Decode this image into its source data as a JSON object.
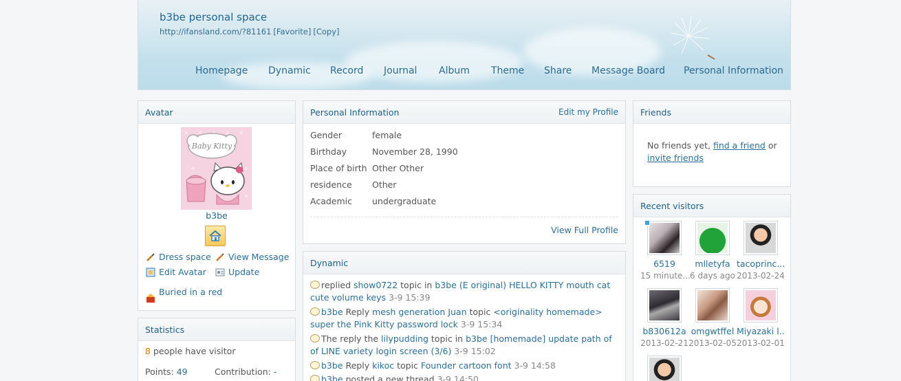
{
  "header": {
    "title": "b3be personal space",
    "url": "http://ifansland.com/?81161",
    "favorite": "[Favorite]",
    "copy": "[Copy]",
    "nav": [
      "Homepage",
      "Dynamic",
      "Record",
      "Journal",
      "Album",
      "Theme",
      "Share",
      "Message Board",
      "Personal Information"
    ]
  },
  "avatar_box": {
    "title": "Avatar",
    "image_text": "Baby Kitty",
    "username": "b3be",
    "actions": {
      "dress": "Dress space",
      "view_message": "View Message",
      "edit_avatar": "Edit Avatar",
      "update": "Update",
      "buried": "Buried in a red"
    }
  },
  "statistics": {
    "title": "Statistics",
    "visitor_count": "8",
    "visitor_text": " people have visitor",
    "points_label": "Points: ",
    "points_value": "49",
    "contribution_label": "Contribution: ",
    "contribution_value": "-"
  },
  "profile": {
    "title": "Personal Information",
    "edit": "Edit my Profile",
    "rows": [
      {
        "key": "Gender",
        "value": "female"
      },
      {
        "key": "Birthday",
        "value": "November 28, 1990"
      },
      {
        "key": "Place of birth",
        "value": "Other Other"
      },
      {
        "key": "residence",
        "value": "Other"
      },
      {
        "key": "Academic",
        "value": "undergraduate"
      }
    ],
    "view_full": "View Full Profile"
  },
  "dynamic": {
    "title": "Dynamic",
    "items": [
      {
        "pre": "replied ",
        "b1": "show0722",
        "mid": " topic in ",
        "b2": "b3be (E original) HELLO KITTY mouth cat cute volume keys",
        "time": " 3-9 15:39"
      },
      {
        "pre": "",
        "b1": "b3be",
        "mid": " Reply ",
        "b2": "mesh generation Juan",
        "mid2": " topic ",
        "b3": "<originality homemade> super the Pink Kitty password lock",
        "time": " 3-9 15:34"
      },
      {
        "pre": "The reply the ",
        "b1": "lilypudding",
        "mid": " topic in ",
        "b2": "b3be [homemade] update path of of LINE variety login screen (3/6)",
        "time": " 3-9 15:02"
      },
      {
        "pre": "",
        "b1": "b3be",
        "mid": " Reply ",
        "b2": "kikoc",
        "mid2": " topic ",
        "b3": "Founder cartoon font",
        "time": " 3-9 14:58"
      },
      {
        "pre": "",
        "b1": "b3be",
        "mid": " posted a new thread",
        "b2": "",
        "time": " 3-9 14:50"
      }
    ]
  },
  "friends": {
    "title": "Friends",
    "pre": "No friends yet, ",
    "find": "find a friend",
    "or": " or ",
    "invite": "invite friends"
  },
  "visitors": {
    "title": "Recent visitors",
    "items": [
      {
        "name": "6519",
        "date": "15 minute...",
        "color": "#c9c2c6"
      },
      {
        "name": "mlletyfa",
        "date": "6 days ago",
        "color": "#22a33a"
      },
      {
        "name": "tacoprinc...",
        "date": "2013-02-24",
        "color": "#d8d8d8"
      },
      {
        "name": "b830612a",
        "date": "2013-02-21",
        "color": "#3a3640"
      },
      {
        "name": "omgwtffel",
        "date": "2013-02-05",
        "color": "#e2c9b8"
      },
      {
        "name": "Miyazaki l...",
        "date": "2013-02-01",
        "color": "#f0d6c8"
      },
      {
        "name": "",
        "date": "",
        "color": "#d8d8d8"
      }
    ]
  },
  "colors": {
    "accent": "#2b6f97",
    "count": "#e07b00"
  }
}
